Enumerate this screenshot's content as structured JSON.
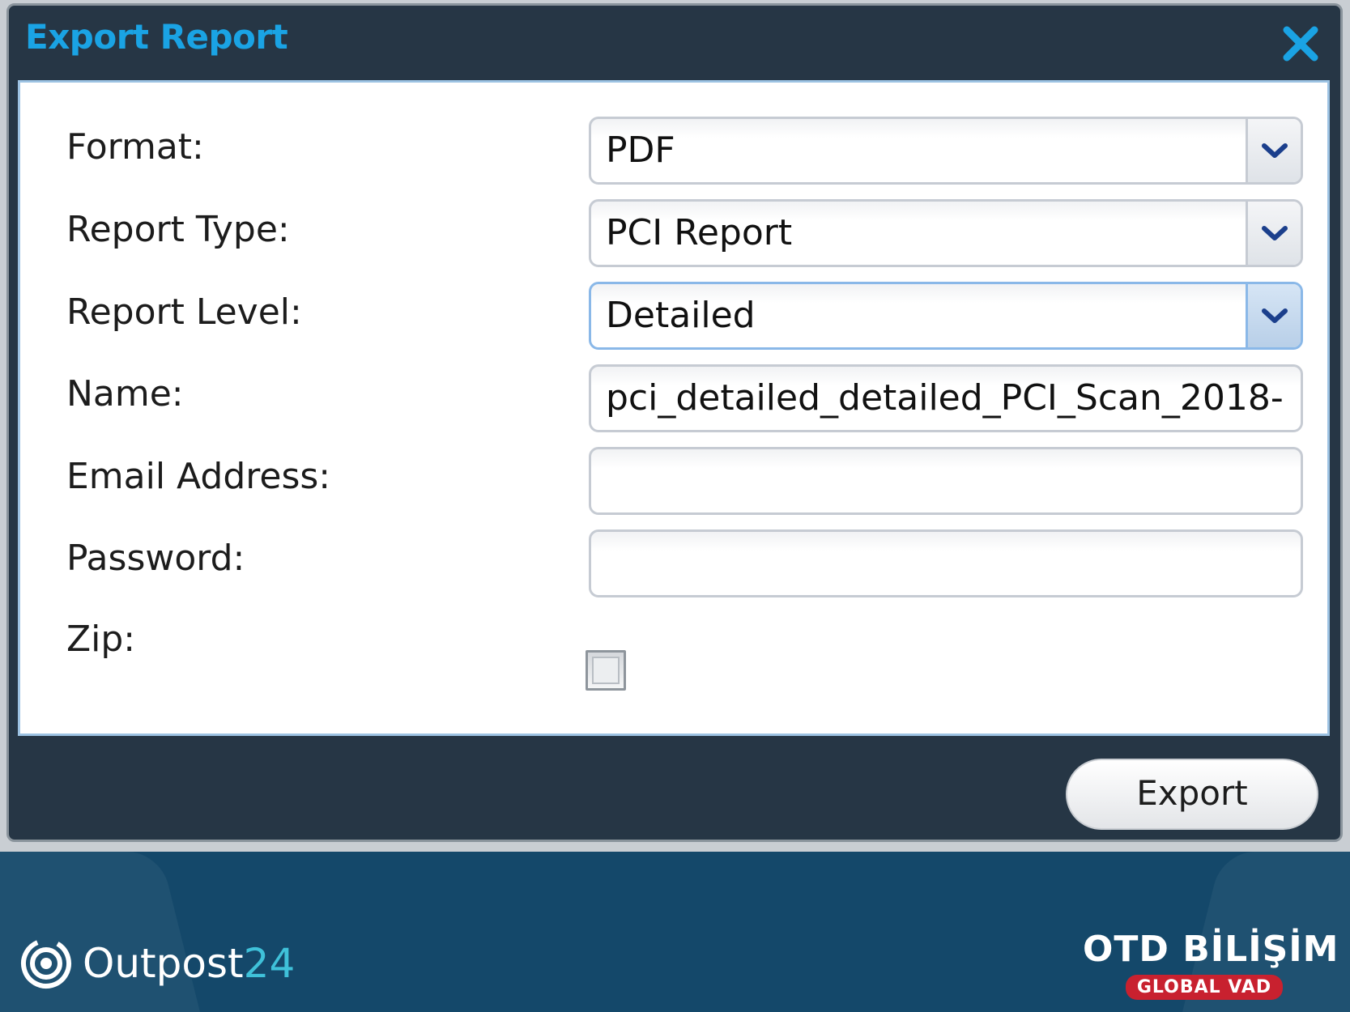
{
  "dialog": {
    "title": "Export Report",
    "fields": {
      "format": {
        "label": "Format:",
        "value": "PDF"
      },
      "report_type": {
        "label": "Report Type:",
        "value": "PCI Report"
      },
      "report_level": {
        "label": "Report Level:",
        "value": "Detailed"
      },
      "name": {
        "label": "Name:",
        "value": "pci_detailed_detailed_PCI_Scan_2018-"
      },
      "email": {
        "label": "Email Address:",
        "value": ""
      },
      "password": {
        "label": "Password:",
        "value": ""
      },
      "zip": {
        "label": "Zip:",
        "checked": false
      }
    },
    "export_label": "Export"
  },
  "footer": {
    "left_brand_text": "Outpost",
    "left_brand_number": "24",
    "right_brand_title": "OTD BİLİŞİM",
    "right_brand_badge": "GLOBAL VAD"
  },
  "colors": {
    "title_blue": "#1aa3e4",
    "dialog_bg": "#263645",
    "footer_bg": "#14486a",
    "badge_red": "#c8212f"
  },
  "icons": {
    "close": "close-icon",
    "dropdown": "chevron-down-icon",
    "logo": "outpost24-logo-icon"
  }
}
